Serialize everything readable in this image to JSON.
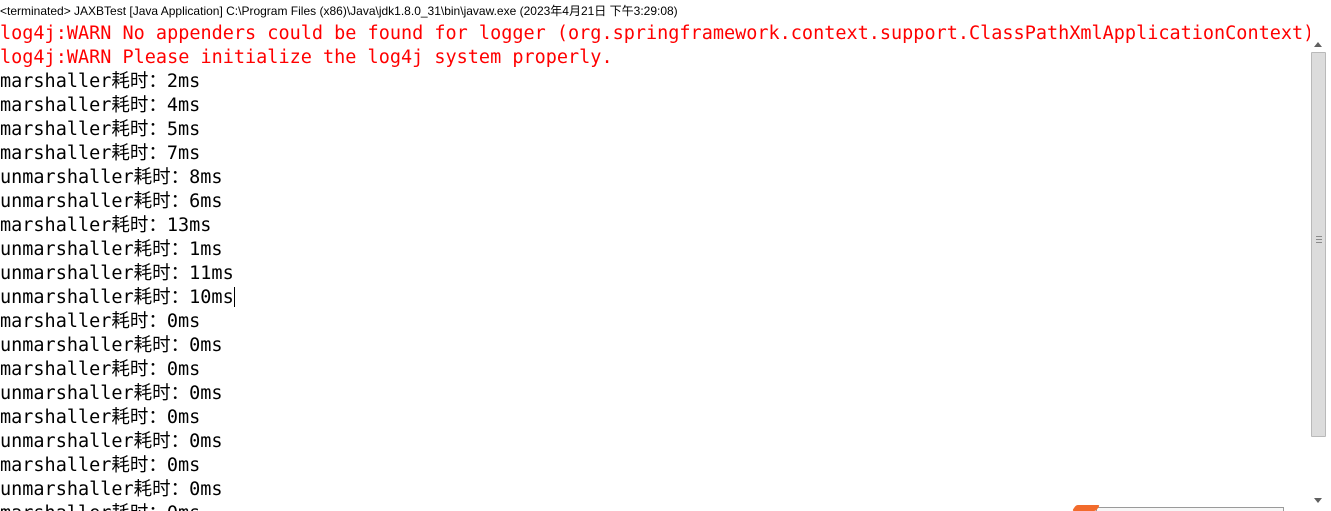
{
  "console": {
    "title": "<terminated> JAXBTest [Java Application] C:\\Program Files (x86)\\Java\\jdk1.8.0_31\\bin\\javaw.exe (2023年4月21日 下午3:29:08)",
    "lines": [
      {
        "text": "log4j:WARN No appenders could be found for logger (org.springframework.context.support.ClassPathXmlApplicationContext).",
        "type": "err"
      },
      {
        "text": "log4j:WARN Please initialize the log4j system properly.",
        "type": "err"
      },
      {
        "text": "marshaller耗时：2ms",
        "type": "out"
      },
      {
        "text": "marshaller耗时：4ms",
        "type": "out"
      },
      {
        "text": "marshaller耗时：5ms",
        "type": "out"
      },
      {
        "text": "marshaller耗时：7ms",
        "type": "out"
      },
      {
        "text": "unmarshaller耗时：8ms",
        "type": "out"
      },
      {
        "text": "unmarshaller耗时：6ms",
        "type": "out"
      },
      {
        "text": "marshaller耗时：13ms",
        "type": "out"
      },
      {
        "text": "unmarshaller耗时：1ms",
        "type": "out"
      },
      {
        "text": "unmarshaller耗时：11ms",
        "type": "out"
      },
      {
        "text": "unmarshaller耗时：10ms",
        "type": "out",
        "caret": true
      },
      {
        "text": "marshaller耗时：0ms",
        "type": "out"
      },
      {
        "text": "unmarshaller耗时：0ms",
        "type": "out"
      },
      {
        "text": "marshaller耗时：0ms",
        "type": "out"
      },
      {
        "text": "unmarshaller耗时：0ms",
        "type": "out"
      },
      {
        "text": "marshaller耗时：0ms",
        "type": "out"
      },
      {
        "text": "unmarshaller耗时：0ms",
        "type": "out"
      },
      {
        "text": "marshaller耗时：0ms",
        "type": "out"
      },
      {
        "text": "unmarshaller耗时：0ms",
        "type": "out"
      },
      {
        "text": "marshaller耗时：0ms",
        "type": "out",
        "partial": true
      }
    ]
  },
  "colors": {
    "stderr": "#ff0000",
    "stdout": "#000000",
    "background": "#ffffff",
    "overlay_accent": "#f26b2c"
  },
  "icons": {
    "scroll_up": "arrow-up-icon",
    "scroll_down": "arrow-down-icon",
    "scroll_grip": "grip-lines-icon"
  }
}
